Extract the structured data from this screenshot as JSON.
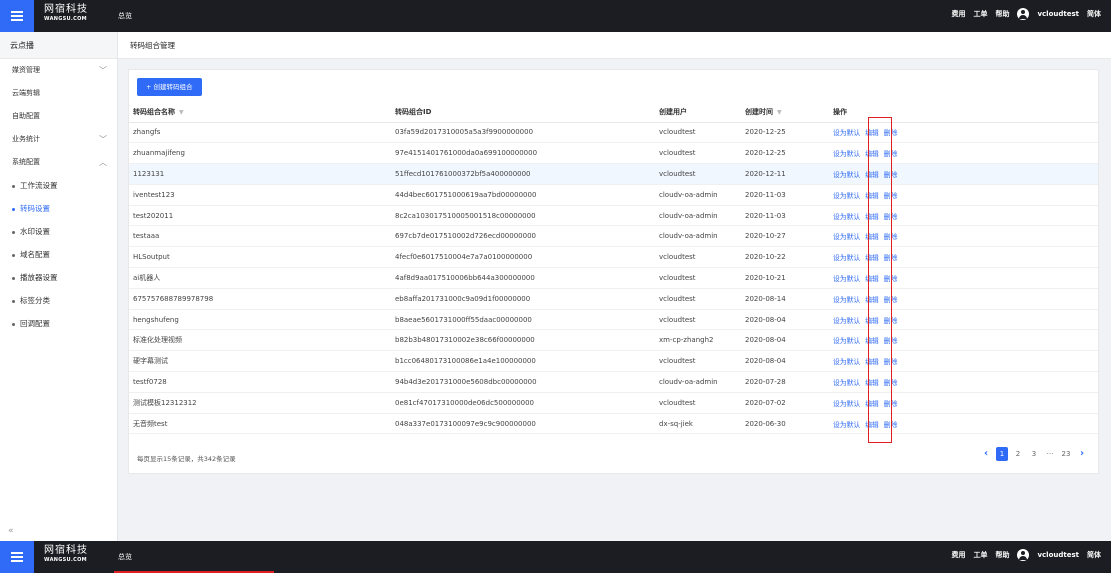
{
  "brand": {
    "cn": "网宿科技",
    "en": "WANGSU.COM"
  },
  "top_nav": {
    "overview": "总览"
  },
  "top_right": {
    "fee": "费用",
    "ticket": "工单",
    "help": "帮助",
    "user": "vcloudtest",
    "lang": "简体"
  },
  "sidebar": {
    "title": "云点播",
    "items": [
      {
        "label": "媒资管理",
        "chevron": "﹀"
      },
      {
        "label": "云端剪辑",
        "chevron": ""
      },
      {
        "label": "自助配置",
        "chevron": ""
      },
      {
        "label": "业务统计",
        "chevron": "﹀"
      },
      {
        "label": "系统配置",
        "chevron": "︿"
      }
    ],
    "subitems": [
      {
        "label": "工作流设置"
      },
      {
        "label": "转码设置",
        "active": true
      },
      {
        "label": "水印设置"
      },
      {
        "label": "域名配置"
      },
      {
        "label": "播放器设置"
      },
      {
        "label": "标签分类"
      },
      {
        "label": "回调配置"
      }
    ],
    "collapse": "«"
  },
  "breadcrumb": "转码组合管理",
  "create_button": "+ 创建转码组合",
  "table": {
    "headers": [
      "转码组合名称",
      "转码组合ID",
      "创建用户",
      "创建时间",
      "操作"
    ],
    "rows": [
      [
        "zhangfs",
        "03fa59d2017310005a5a3f9900000000",
        "vcloudtest",
        "2020-12-25"
      ],
      [
        "zhuanmajifeng",
        "97e4151401761000da0a699100000000",
        "vcloudtest",
        "2020-12-25"
      ],
      [
        "1123131",
        "51ffecd101761000372bf5a400000000",
        "vcloudtest",
        "2020-12-11"
      ],
      [
        "iventest123",
        "44d4bec601751000619aa7bd00000000",
        "cloudv-oa-admin",
        "2020-11-03"
      ],
      [
        "test202011",
        "8c2ca103017510005001518c00000000",
        "cloudv-oa-admin",
        "2020-11-03"
      ],
      [
        "testaaa",
        "697cb7de017510002d726ecd00000000",
        "cloudv-oa-admin",
        "2020-10-27"
      ],
      [
        "HLSoutput",
        "4fecf0e6017510004e7a7a0100000000",
        "vcloudtest",
        "2020-10-22"
      ],
      [
        "ai机器人",
        "4af8d9aa017510006bb644a300000000",
        "vcloudtest",
        "2020-10-21"
      ],
      [
        "675757688789978798",
        "eb8affa201731000c9a09d1f00000000",
        "vcloudtest",
        "2020-08-14"
      ],
      [
        "hengshufeng",
        "b8aeae5601731000ff55daac00000000",
        "vcloudtest",
        "2020-08-04"
      ],
      [
        "标准化处理视频",
        "b82b3b48017310002e38c66f00000000",
        "xm-cp-zhangh2",
        "2020-08-04"
      ],
      [
        "硬字幕测试",
        "b1cc06480173100086e1a4e100000000",
        "vcloudtest",
        "2020-08-04"
      ],
      [
        "testf0728",
        "94b4d3e201731000e5608dbc00000000",
        "cloudv-oa-admin",
        "2020-07-28"
      ],
      [
        "测试模板12312312",
        "0e81cf47017310000de06dc500000000",
        "vcloudtest",
        "2020-07-02"
      ],
      [
        "无音频test",
        "048a337e0173100097e9c9c900000000",
        "dx-sq-jiek",
        "2020-06-30"
      ]
    ],
    "actions": [
      "设为默认",
      "编辑",
      "删除"
    ]
  },
  "footer": {
    "info": "每页显示15条记录，共342条记录"
  },
  "pagination": {
    "pages": [
      "1",
      "2",
      "3",
      "···",
      "23"
    ],
    "current": "1"
  },
  "colors": {
    "accent": "#2f6bf6",
    "topbar": "#1b1d22",
    "highlight_box": "#e02020"
  }
}
